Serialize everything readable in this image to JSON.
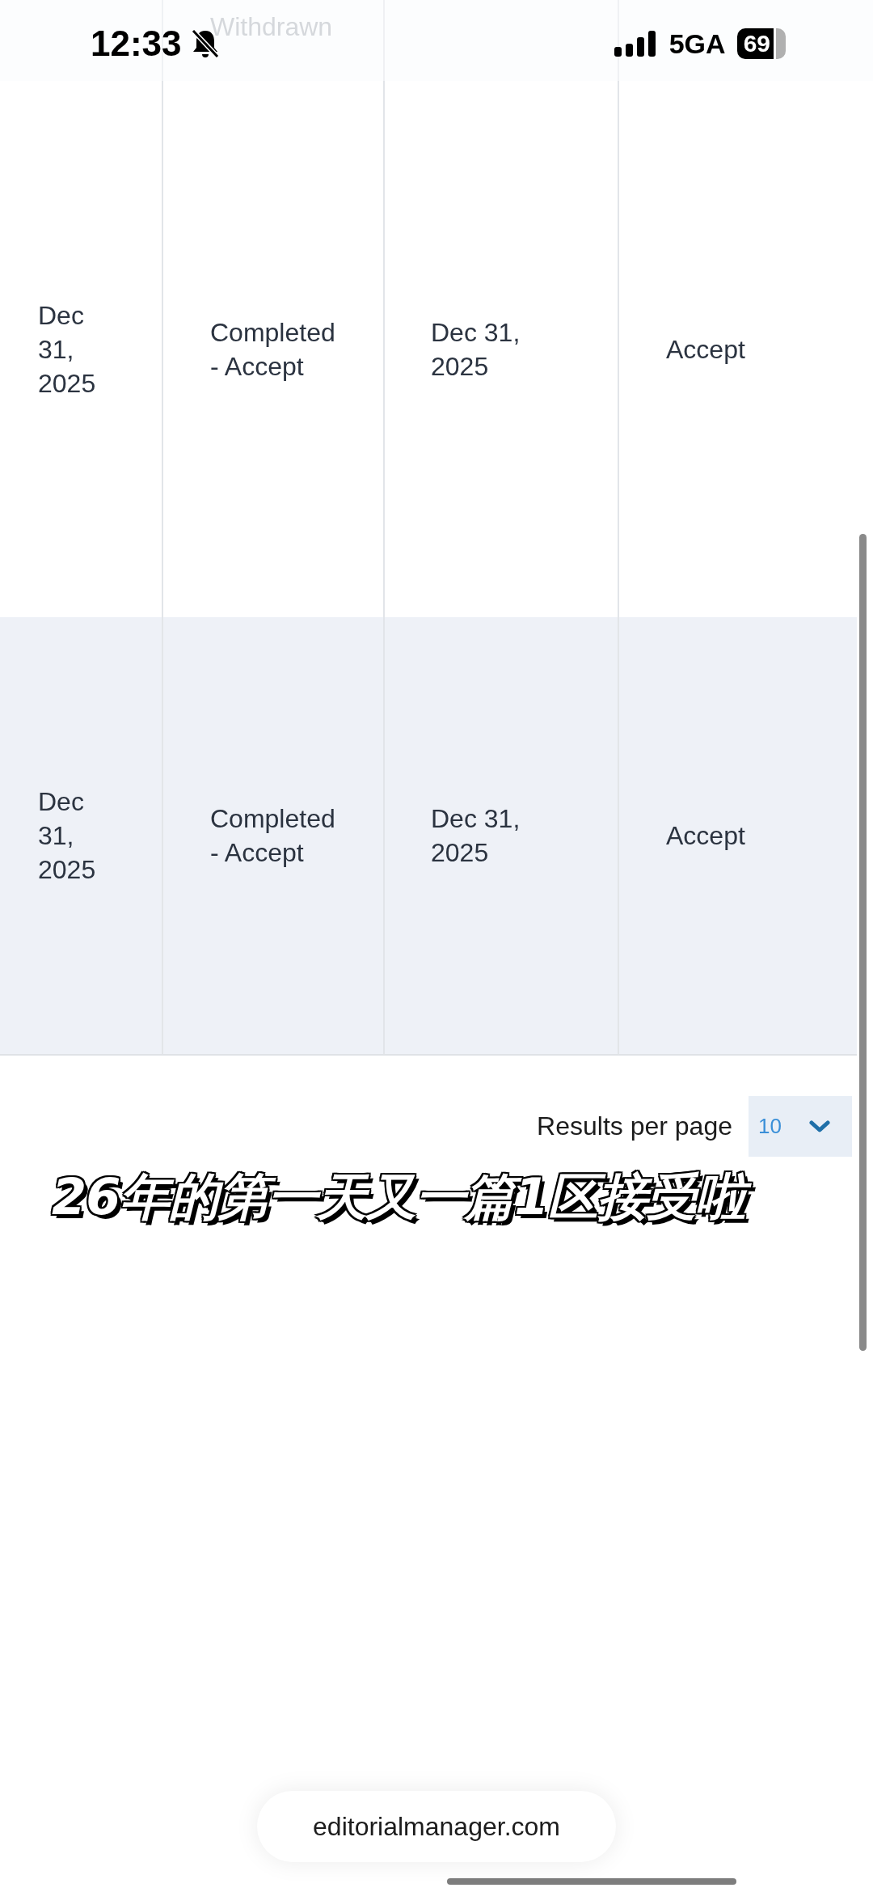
{
  "status_bar": {
    "time": "12:33",
    "network": "5GA",
    "battery": "69"
  },
  "table": {
    "rows": [
      {
        "column_2": "Withdrawn"
      },
      {
        "column_1": "Dec 31, 2025",
        "column_2": "Completed - Accept",
        "column_3": "Dec 31, 2025",
        "column_4": "Accept",
        "shaded": false
      },
      {
        "column_1": "Dec 31, 2025",
        "column_2": "Completed - Accept",
        "column_3": "Dec 31, 2025",
        "column_4": "Accept",
        "shaded": true
      }
    ]
  },
  "pagination": {
    "label": "Results per page",
    "value": "10"
  },
  "caption": "26年的第一天又一篇1区接受啦",
  "address_bar": {
    "url": "editorialmanager.com"
  }
}
